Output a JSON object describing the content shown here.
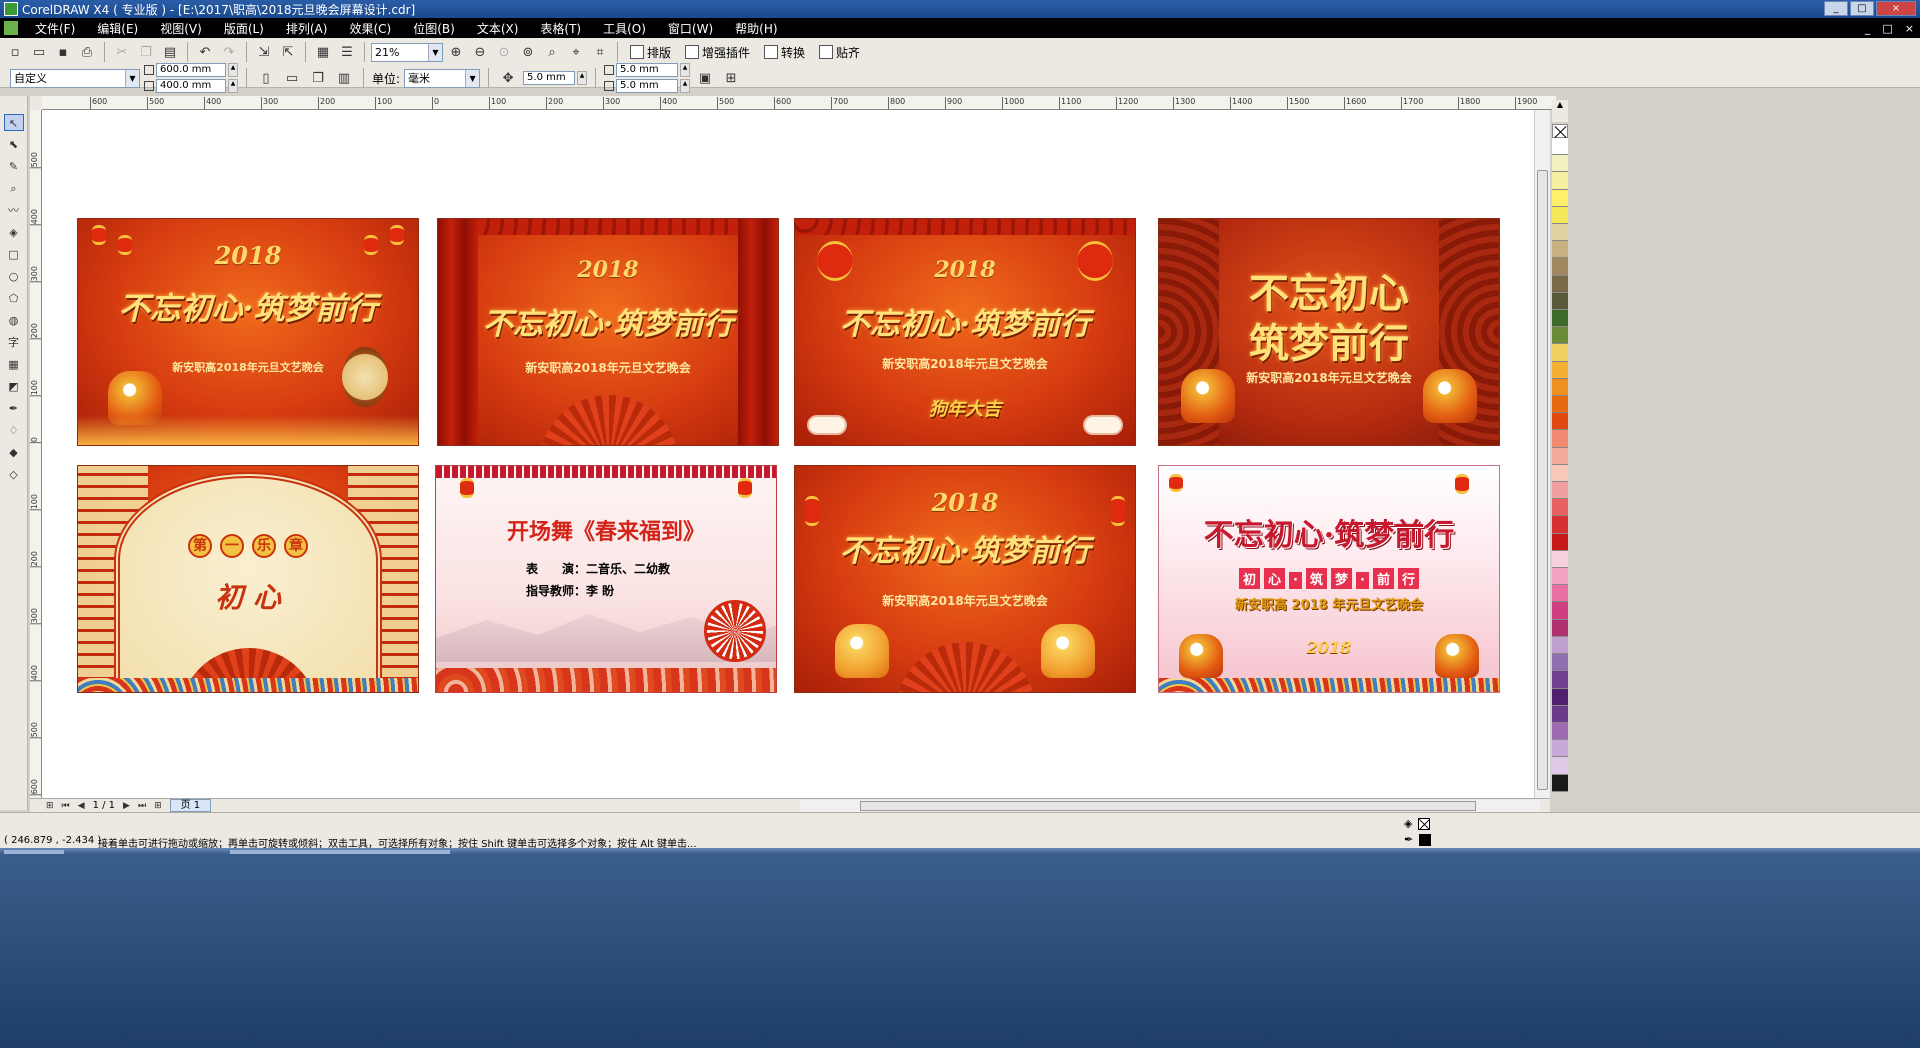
{
  "window": {
    "title": "CorelDRAW X4 ( 专业版 ) - [E:\\2017\\职高\\2018元旦晚会屏幕设计.cdr]",
    "controls": [
      "_",
      "□",
      "×"
    ]
  },
  "menu": {
    "items": [
      "文件(F)",
      "编辑(E)",
      "视图(V)",
      "版面(L)",
      "排列(A)",
      "效果(C)",
      "位图(B)",
      "文本(X)",
      "表格(T)",
      "工具(O)",
      "窗口(W)",
      "帮助(H)"
    ],
    "doc_controls": [
      "_",
      "□",
      "×"
    ]
  },
  "toolbar": {
    "zoom": "21%",
    "plugin_buttons": [
      "排版",
      "增强插件",
      "转换",
      "贴齐"
    ]
  },
  "property_bar": {
    "page_preset": "自定义",
    "width": "600.0 mm",
    "height": "400.0 mm",
    "unit_label": "单位:",
    "unit_value": "毫米",
    "nudge": "5.0 mm",
    "dup_x": "5.0 mm",
    "dup_y": "5.0 mm"
  },
  "rulers": {
    "h_ticks": [
      "600",
      "500",
      "400",
      "300",
      "200",
      "100",
      "0",
      "100",
      "200",
      "300",
      "400",
      "500",
      "600",
      "700",
      "800",
      "900",
      "1000",
      "1100",
      "1200",
      "1300",
      "1400",
      "1500",
      "1600",
      "1700",
      "1800",
      "1900"
    ],
    "v_ticks": [
      "500",
      "400",
      "300",
      "200",
      "100",
      "0",
      "100",
      "200",
      "300",
      "400",
      "500",
      "600"
    ],
    "corner_label": "毫米"
  },
  "slides": [
    {
      "year": "2018",
      "headline": "不忘初心·筑梦前行",
      "subtitle": "新安职高2018年元旦文艺晚会"
    },
    {
      "year": "2018",
      "headline": "不忘初心·筑梦前行",
      "subtitle": "新安职高2018年元旦文艺晚会"
    },
    {
      "year": "2018",
      "headline": "不忘初心·筑梦前行",
      "subtitle": "新安职高2018年元旦文艺晚会",
      "tag": "狗年大吉"
    },
    {
      "headline_line1": "不忘初心",
      "headline_line2": "筑梦前行",
      "subtitle": "新安职高2018年元旦文艺晚会"
    },
    {
      "badges": [
        "第",
        "一",
        "乐",
        "章"
      ],
      "title": "初 心"
    },
    {
      "title": "开场舞《春来福到》",
      "line1": "表　　演：二音乐、二幼教",
      "line2": "指导教师：李 盼"
    },
    {
      "year": "2018",
      "headline": "不忘初心·筑梦前行",
      "subtitle": "新安职高2018年元旦文艺晚会"
    },
    {
      "headline": "不忘初心·筑梦前行",
      "tags": [
        "初",
        "心",
        "·",
        "筑",
        "梦",
        "·",
        "前",
        "行"
      ],
      "subtitle": "新安职高 2018 年元旦文艺晚会",
      "year": "2018"
    }
  ],
  "pager": {
    "position": "1 / 1",
    "page_tab": "页 1"
  },
  "palette": [
    "#ffffff",
    "#f2f2c0",
    "#f7f0a0",
    "#fff06a",
    "#f4e85a",
    "#e0d2a0",
    "#c8b080",
    "#a08860",
    "#7a6a48",
    "#5a5a3a",
    "#3e6a2a",
    "#6a8a3a",
    "#f0d060",
    "#f4b030",
    "#f09020",
    "#e86a10",
    "#e04a10",
    "#f08a70",
    "#f4a898",
    "#f8c8b8",
    "#f0a0a0",
    "#e86060",
    "#d83030",
    "#c81a1a",
    "#f8d0e0",
    "#f4a0c0",
    "#e870a0",
    "#d04080",
    "#b03070",
    "#c0a0d0",
    "#9070b0",
    "#704090",
    "#502070",
    "#6a3a8a",
    "#a06ab0",
    "#c8a8d8",
    "#e0c8e8",
    "#1a1a1a"
  ],
  "status": {
    "coords": "( 246.879 , -2.434 )",
    "hint": "接着单击可进行拖动或缩放；再单击可旋转或倾斜；双击工具，可选择所有对象；按住 Shift 键单击可选择多个对象；按住 Alt 键单击..."
  }
}
